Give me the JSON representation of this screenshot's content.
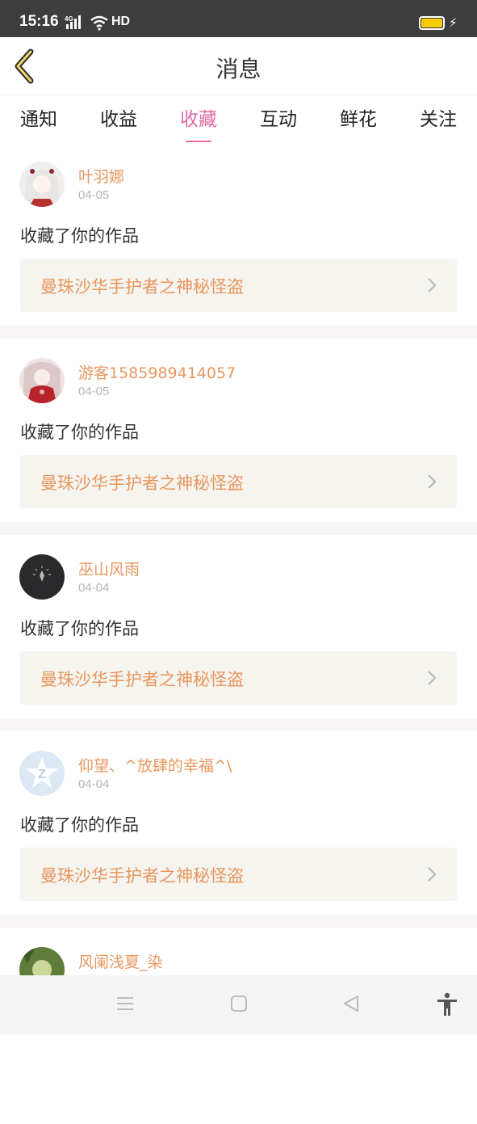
{
  "status": {
    "time": "15:16",
    "network": "4G",
    "hd": "HD",
    "battery_color": "#f6c900"
  },
  "header": {
    "title": "消息",
    "back_icon": "chevron-left-icon"
  },
  "tabs": [
    {
      "label": "通知"
    },
    {
      "label": "收益"
    },
    {
      "label": "收藏",
      "active": true
    },
    {
      "label": "互动"
    },
    {
      "label": "鲜花"
    },
    {
      "label": "关注"
    }
  ],
  "accent_color": "#e16aa1",
  "messages": [
    {
      "user": "叶羽娜",
      "date": "04-05",
      "action": "收藏了你的作品",
      "work": "曼珠沙华手护者之神秘怪盗"
    },
    {
      "user": "游客1585989414057",
      "date": "04-05",
      "action": "收藏了你的作品",
      "work": "曼珠沙华手护者之神秘怪盗"
    },
    {
      "user": "巫山风雨",
      "date": "04-04",
      "action": "收藏了你的作品",
      "work": "曼珠沙华手护者之神秘怪盗"
    },
    {
      "user": "仰望、^放肆的幸福^\\",
      "date": "04-04",
      "action": "收藏了你的作品",
      "work": "曼珠沙华手护者之神秘怪盗"
    },
    {
      "user": "风阑浅夏_染"
    }
  ],
  "navbar": {
    "icons": [
      "menu-icon",
      "home-square-icon",
      "back-triangle-icon",
      "accessibility-icon"
    ]
  }
}
